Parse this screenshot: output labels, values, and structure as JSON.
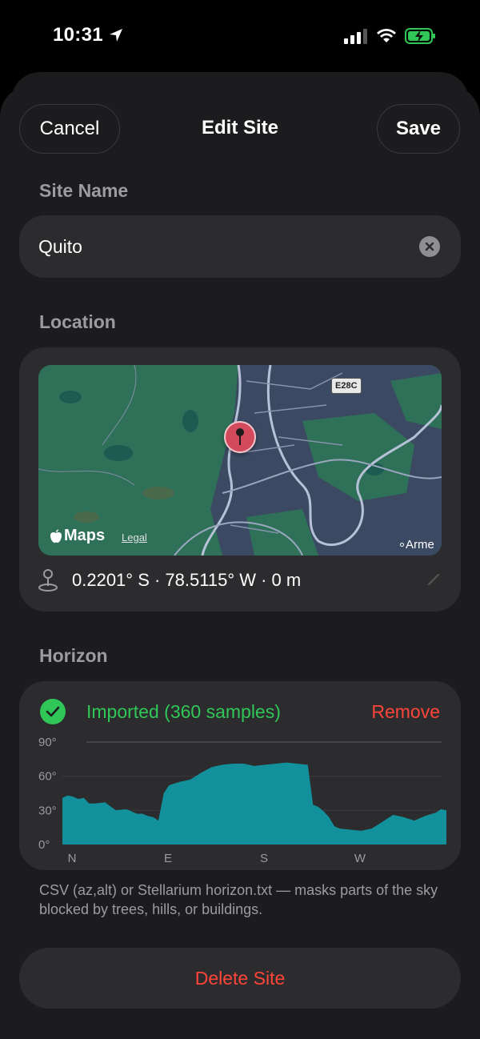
{
  "status": {
    "time": "10:31",
    "location_icon": "location-arrow-icon",
    "signal_icon": "cellular-signal-icon",
    "wifi_icon": "wifi-icon",
    "battery_icon": "battery-charging-icon"
  },
  "nav": {
    "cancel": "Cancel",
    "title": "Edit Site",
    "save": "Save"
  },
  "site_name": {
    "label": "Site Name",
    "value": "Quito"
  },
  "location": {
    "label": "Location",
    "map": {
      "brand": "Maps",
      "legal": "Legal",
      "road_badge": "E28C",
      "place": "Arme"
    },
    "coords": "0.2201° S · 78.5115° W · 0 m"
  },
  "horizon": {
    "label": "Horizon",
    "status": "Imported (360 samples)",
    "remove": "Remove",
    "y_ticks": [
      "90°",
      "60°",
      "30°",
      "0°"
    ],
    "x_ticks": [
      "N",
      "E",
      "S",
      "W"
    ],
    "colors": {
      "fill": "#12909b",
      "accent": "#30c758",
      "danger": "#ff453a"
    }
  },
  "chart_data": {
    "type": "area",
    "title": "",
    "xlabel": "",
    "ylabel": "",
    "x_categories": [
      "N",
      "E",
      "S",
      "W"
    ],
    "xlim": [
      0,
      360
    ],
    "ylim": [
      0,
      90
    ],
    "x": [
      0,
      5,
      10,
      15,
      20,
      25,
      30,
      40,
      50,
      60,
      70,
      75,
      80,
      85,
      90,
      95,
      100,
      110,
      120,
      130,
      140,
      150,
      160,
      170,
      180,
      190,
      200,
      210,
      220,
      230,
      235,
      240,
      245,
      250,
      255,
      260,
      270,
      280,
      290,
      300,
      310,
      320,
      330,
      340,
      350,
      355,
      360
    ],
    "y": [
      41,
      43,
      42,
      40,
      41,
      36,
      36,
      37,
      30,
      31,
      27,
      27,
      25,
      24,
      21,
      45,
      52,
      55,
      57,
      63,
      68,
      70,
      71,
      71,
      69,
      70,
      71,
      72,
      71,
      70,
      35,
      33,
      29,
      24,
      16,
      14,
      13,
      12,
      14,
      20,
      26,
      24,
      21,
      25,
      28,
      31,
      30
    ]
  },
  "caption": "CSV (az,alt) or Stellarium horizon.txt — masks parts of the sky blocked by trees, hills, or buildings.",
  "delete": "Delete Site"
}
